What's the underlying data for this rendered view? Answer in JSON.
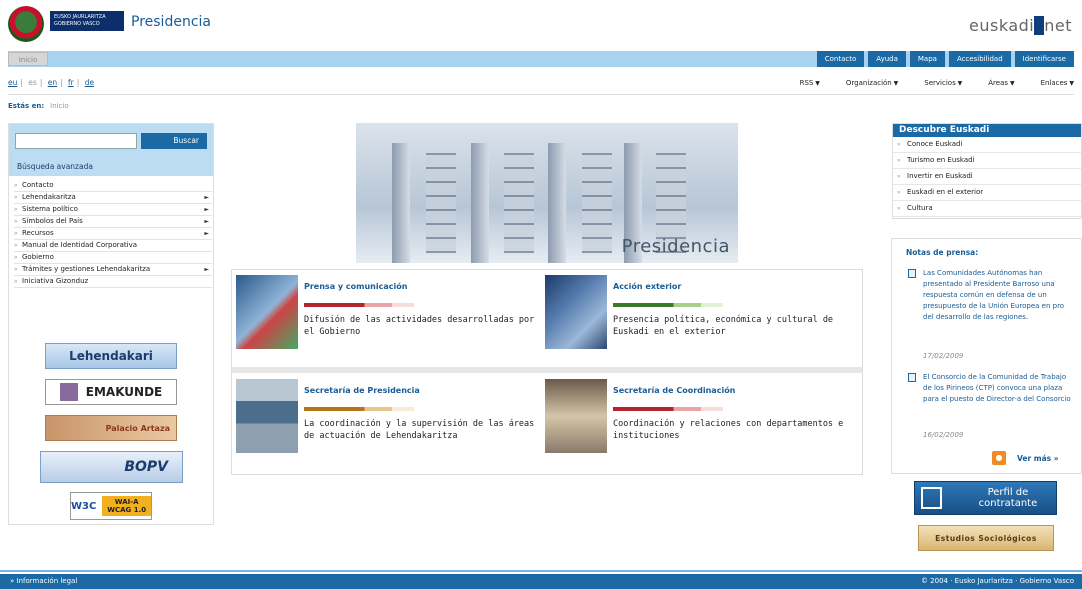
{
  "header": {
    "gov_banner_line1": "EUSKO JAURLARITZA",
    "gov_banner_line2": "GOBIERNO VASCO",
    "site_title": "Presidencia",
    "brand_left": "euskadi",
    "brand_right": "net"
  },
  "nav": {
    "home": "Inicio",
    "links": [
      "Contacto",
      "Ayuda",
      "Mapa",
      "Accesibilidad",
      "Identificarse"
    ]
  },
  "languages": [
    "eu",
    "es",
    "en",
    "fr",
    "de"
  ],
  "menus": [
    "RSS",
    "Organización",
    "Servicios",
    "Áreas",
    "Enlaces"
  ],
  "breadcrumb": {
    "label": "Estás en:",
    "current": "Inicio"
  },
  "search": {
    "button": "Buscar",
    "advanced": "Búsqueda avanzada",
    "value": ""
  },
  "left_menu": [
    {
      "label": "Contacto",
      "arrow": ""
    },
    {
      "label": "Lehendakaritza",
      "arrow": "►"
    },
    {
      "label": "Sistema político",
      "arrow": "►"
    },
    {
      "label": "Símbolos del País",
      "arrow": "►"
    },
    {
      "label": "Recursos",
      "arrow": "►"
    },
    {
      "label": "Manual de Identidad Corporativa",
      "arrow": ""
    },
    {
      "label": "Gobierno",
      "arrow": ""
    },
    {
      "label": "Trámites y gestiones Lehendakaritza",
      "arrow": "►"
    },
    {
      "label": "Iniciativa Gizonduz",
      "arrow": ""
    }
  ],
  "banners": {
    "lehendakari": "Lehendakari",
    "emakunde": "EMAKUNDE",
    "palacio": "Palacio Artaza",
    "bopv": "BOPV",
    "wai_logo": "W3C",
    "wai_badge": "WAI-A WCAG 1.0"
  },
  "hero": {
    "title": "Presidencia"
  },
  "cards": [
    {
      "title": "Prensa y comunicación",
      "desc": "Difusión de las actividades desarrolladas por el Gobierno"
    },
    {
      "title": "Acción exterior",
      "desc": "Presencia política, económica y cultural de Euskadi en el exterior"
    },
    {
      "title": "Secretaría de Presidencia",
      "desc": "La coordinación y la supervisión de las áreas de actuación de Lehendakaritza"
    },
    {
      "title": "Secretaría de Coordinación",
      "desc": "Coordinación y relaciones con departamentos e instituciones"
    }
  ],
  "discover": {
    "title": "Descubre Euskadi",
    "items": [
      "Conoce Euskadi",
      "Turismo en Euskadi",
      "Invertir en Euskadi",
      "Euskadi en el exterior",
      "Cultura"
    ]
  },
  "press": {
    "title": "Notas de prensa:",
    "items": [
      {
        "text": "Las Comunidades Autónomas han presentado al Presidente Barroso una respuesta común en defensa de un presupuesto de la Unión Europea en pro del desarrollo de las regiones.",
        "date": "17/02/2009"
      },
      {
        "text": "El Consorcio de la Comunidad de Trabajo de los Pirineos (CTP) convoca una plaza para el puesto de Director-a del Consorcio",
        "date": "16/02/2009"
      }
    ],
    "more": "Ver más"
  },
  "promos": {
    "perfil": "Perfil de contratante",
    "estudios": "Estudios Sociológicos"
  },
  "footer": {
    "legal": "Información legal",
    "copyright": "© 2004 · Eusko Jaurlaritza · Gobierno Vasco"
  }
}
